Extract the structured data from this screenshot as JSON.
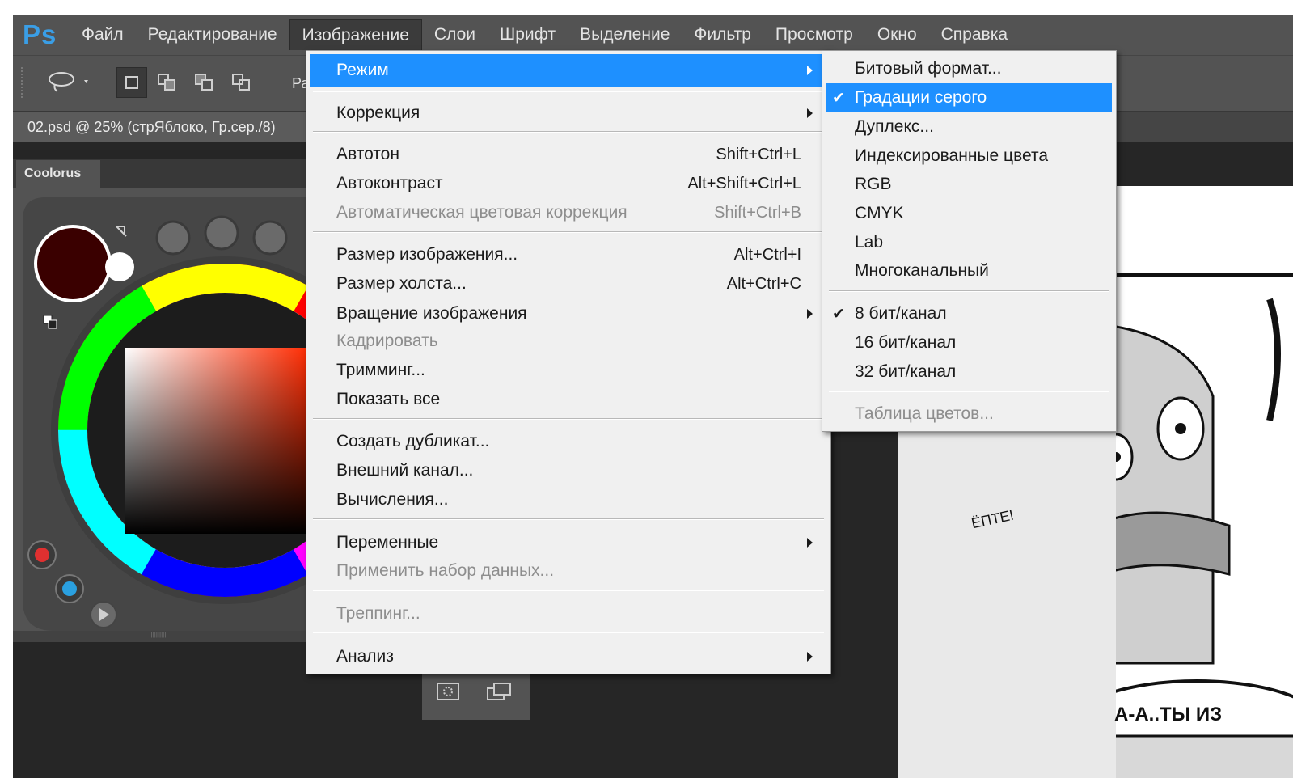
{
  "app": {
    "logo": "Ps"
  },
  "menubar": [
    "Файл",
    "Редактирование",
    "Изображение",
    "Слои",
    "Шрифт",
    "Выделение",
    "Фильтр",
    "Просмотр",
    "Окно",
    "Справка"
  ],
  "options": {
    "extra_label": "Ра"
  },
  "document": {
    "tab_title": "02.psd @ 25% (стрЯблоко, Гр.сер./8)"
  },
  "panel": {
    "title": "Coolorus",
    "current_color": "#3a0000"
  },
  "image_menu": {
    "mode": "Режим",
    "correction": "Коррекция",
    "autotone": "Автотон",
    "autotone_sc": "Shift+Ctrl+L",
    "autocontrast": "Автоконтраст",
    "autocontrast_sc": "Alt+Shift+Ctrl+L",
    "autocolor": "Автоматическая цветовая коррекция",
    "autocolor_sc": "Shift+Ctrl+B",
    "image_size": "Размер изображения...",
    "image_size_sc": "Alt+Ctrl+I",
    "canvas_size": "Размер холста...",
    "canvas_size_sc": "Alt+Ctrl+C",
    "rotation": "Вращение изображения",
    "crop": "Кадрировать",
    "trim": "Тримминг...",
    "reveal_all": "Показать все",
    "duplicate": "Создать дубликат...",
    "apply_image": "Внешний канал...",
    "calculations": "Вычисления...",
    "variables": "Переменные",
    "apply_dataset": "Применить набор данных...",
    "trapping": "Треппинг...",
    "analysis": "Анализ"
  },
  "mode_menu": {
    "bitmap": "Битовый формат...",
    "grayscale": "Градации серого",
    "duotone": "Дуплекс...",
    "indexed": "Индексированные цвета",
    "rgb": "RGB",
    "cmyk": "CMYK",
    "lab": "Lab",
    "multichannel": "Многоканальный",
    "bit8": "8 бит/канал",
    "bit16": "16 бит/канал",
    "bit32": "32 бит/канал",
    "color_table": "Таблица цветов...",
    "check": "✔"
  },
  "comic": {
    "bubble_text": "А-А..ТЫ ИЗ",
    "shout_text": "ЁПТЕ!"
  }
}
